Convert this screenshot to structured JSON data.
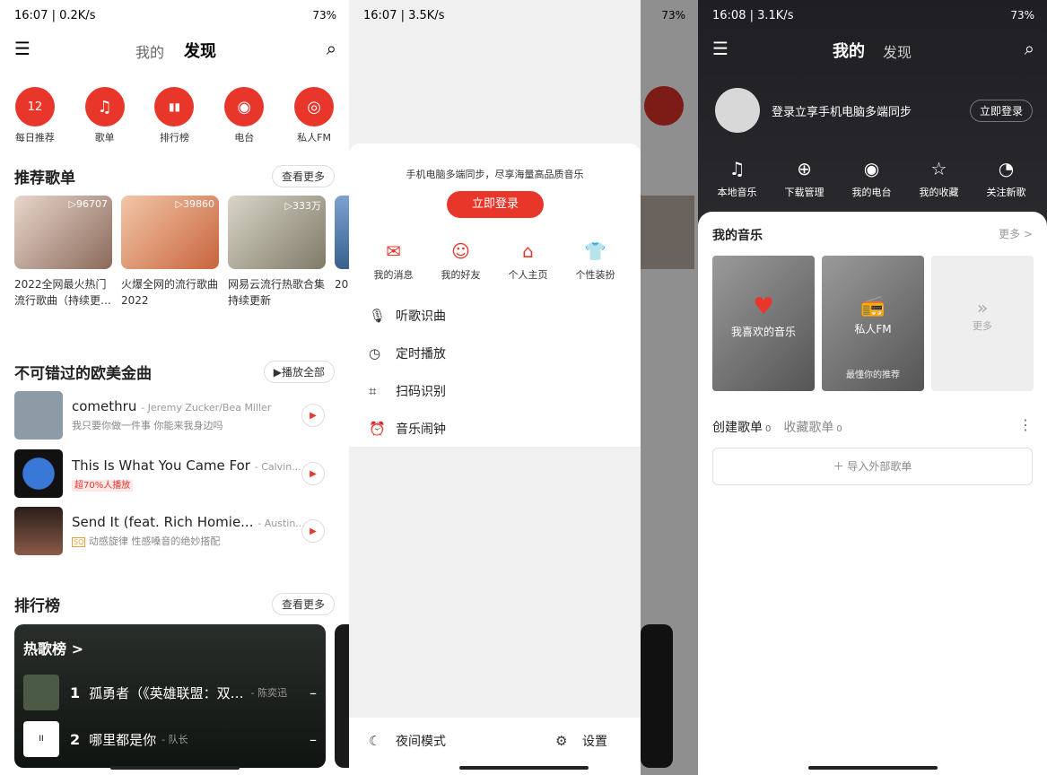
{
  "screen1": {
    "status_time": "16:07 | 0.2K/s",
    "battery": "73%",
    "tabs": [
      "我的",
      "发现"
    ],
    "quick": [
      {
        "label": "每日推荐",
        "icon": "calendar-icon",
        "glyph": "12"
      },
      {
        "label": "歌单",
        "icon": "playlist-icon",
        "glyph": "♫"
      },
      {
        "label": "排行榜",
        "icon": "chart-icon",
        "glyph": "▮▮"
      },
      {
        "label": "电台",
        "icon": "radio-icon",
        "glyph": "◉"
      },
      {
        "label": "私人FM",
        "icon": "fm-icon",
        "glyph": "◎"
      }
    ],
    "rec_title": "推荐歌单",
    "more": "查看更多",
    "playlists": [
      {
        "count": "▷96707",
        "title": "2022全网最火热门流行歌曲（持续更…"
      },
      {
        "count": "▷39860",
        "title": "火爆全网的流行歌曲2022"
      },
      {
        "count": "▷333万",
        "title": "网易云流行热歌合集持续更新"
      },
      {
        "count": "",
        "title": "20…"
      }
    ],
    "west_title": "不可错过的欧美金曲",
    "play_all": "▶播放全部",
    "songs": [
      {
        "name": "comethru",
        "artist": "- Jeremy Zucker/Bea Miller",
        "sub": "我只要你做一件事 你能来我身边吗"
      },
      {
        "name": "This Is What You Came For",
        "artist": "- Calvin...",
        "tag": "超70%人播放"
      },
      {
        "name": "Send It (feat. Rich Homie...",
        "artist": "- Austin...",
        "badge": "SQ",
        "sub": "动感旋律 性感嗓音的绝妙搭配"
      }
    ],
    "rank_title": "排行榜",
    "hot": "热歌榜 >",
    "ranks": [
      {
        "n": "1",
        "name": "孤勇者（《英雄联盟：双…",
        "artist": "- 陈奕迅"
      },
      {
        "n": "2",
        "name": "哪里都是你",
        "artist": "- 队长"
      }
    ]
  },
  "screen2": {
    "status_time": "16:07 | 3.5K/s",
    "battery": "73%",
    "promo": "手机电脑多端同步，尽享海量高品质音乐",
    "login": "立即登录",
    "icons": [
      {
        "label": "我的消息",
        "glyph": "✉"
      },
      {
        "label": "我的好友",
        "glyph": "☺"
      },
      {
        "label": "个人主页",
        "glyph": "⌂"
      },
      {
        "label": "个性装扮",
        "glyph": "👕"
      }
    ],
    "menu": [
      {
        "label": "听歌识曲",
        "glyph": "🎙"
      },
      {
        "label": "定时播放",
        "glyph": "◷"
      },
      {
        "label": "扫码识别",
        "glyph": "⌗"
      },
      {
        "label": "音乐闹钟",
        "glyph": "⏰"
      }
    ],
    "night": "夜间模式",
    "settings": "设置"
  },
  "screen3": {
    "status_time": "16:08 | 3.1K/s",
    "battery": "73%",
    "tabs": [
      "我的",
      "发现"
    ],
    "login_text": "登录立享手机电脑多端同步",
    "login": "立即登录",
    "icons": [
      {
        "label": "本地音乐",
        "glyph": "♫"
      },
      {
        "label": "下载管理",
        "glyph": "⊕"
      },
      {
        "label": "我的电台",
        "glyph": "◉"
      },
      {
        "label": "我的收藏",
        "glyph": "☆"
      },
      {
        "label": "关注新歌",
        "glyph": "◔"
      }
    ],
    "my_music": "我的音乐",
    "more": "更多 >",
    "liked": "我喜欢的音乐",
    "fm": "私人FM",
    "fm_sub": "最懂你的推荐",
    "tile_more": "更多",
    "created": "创建歌单",
    "created_n": "0",
    "fav": "收藏歌单",
    "fav_n": "0",
    "import": "＋ 导入外部歌单"
  }
}
